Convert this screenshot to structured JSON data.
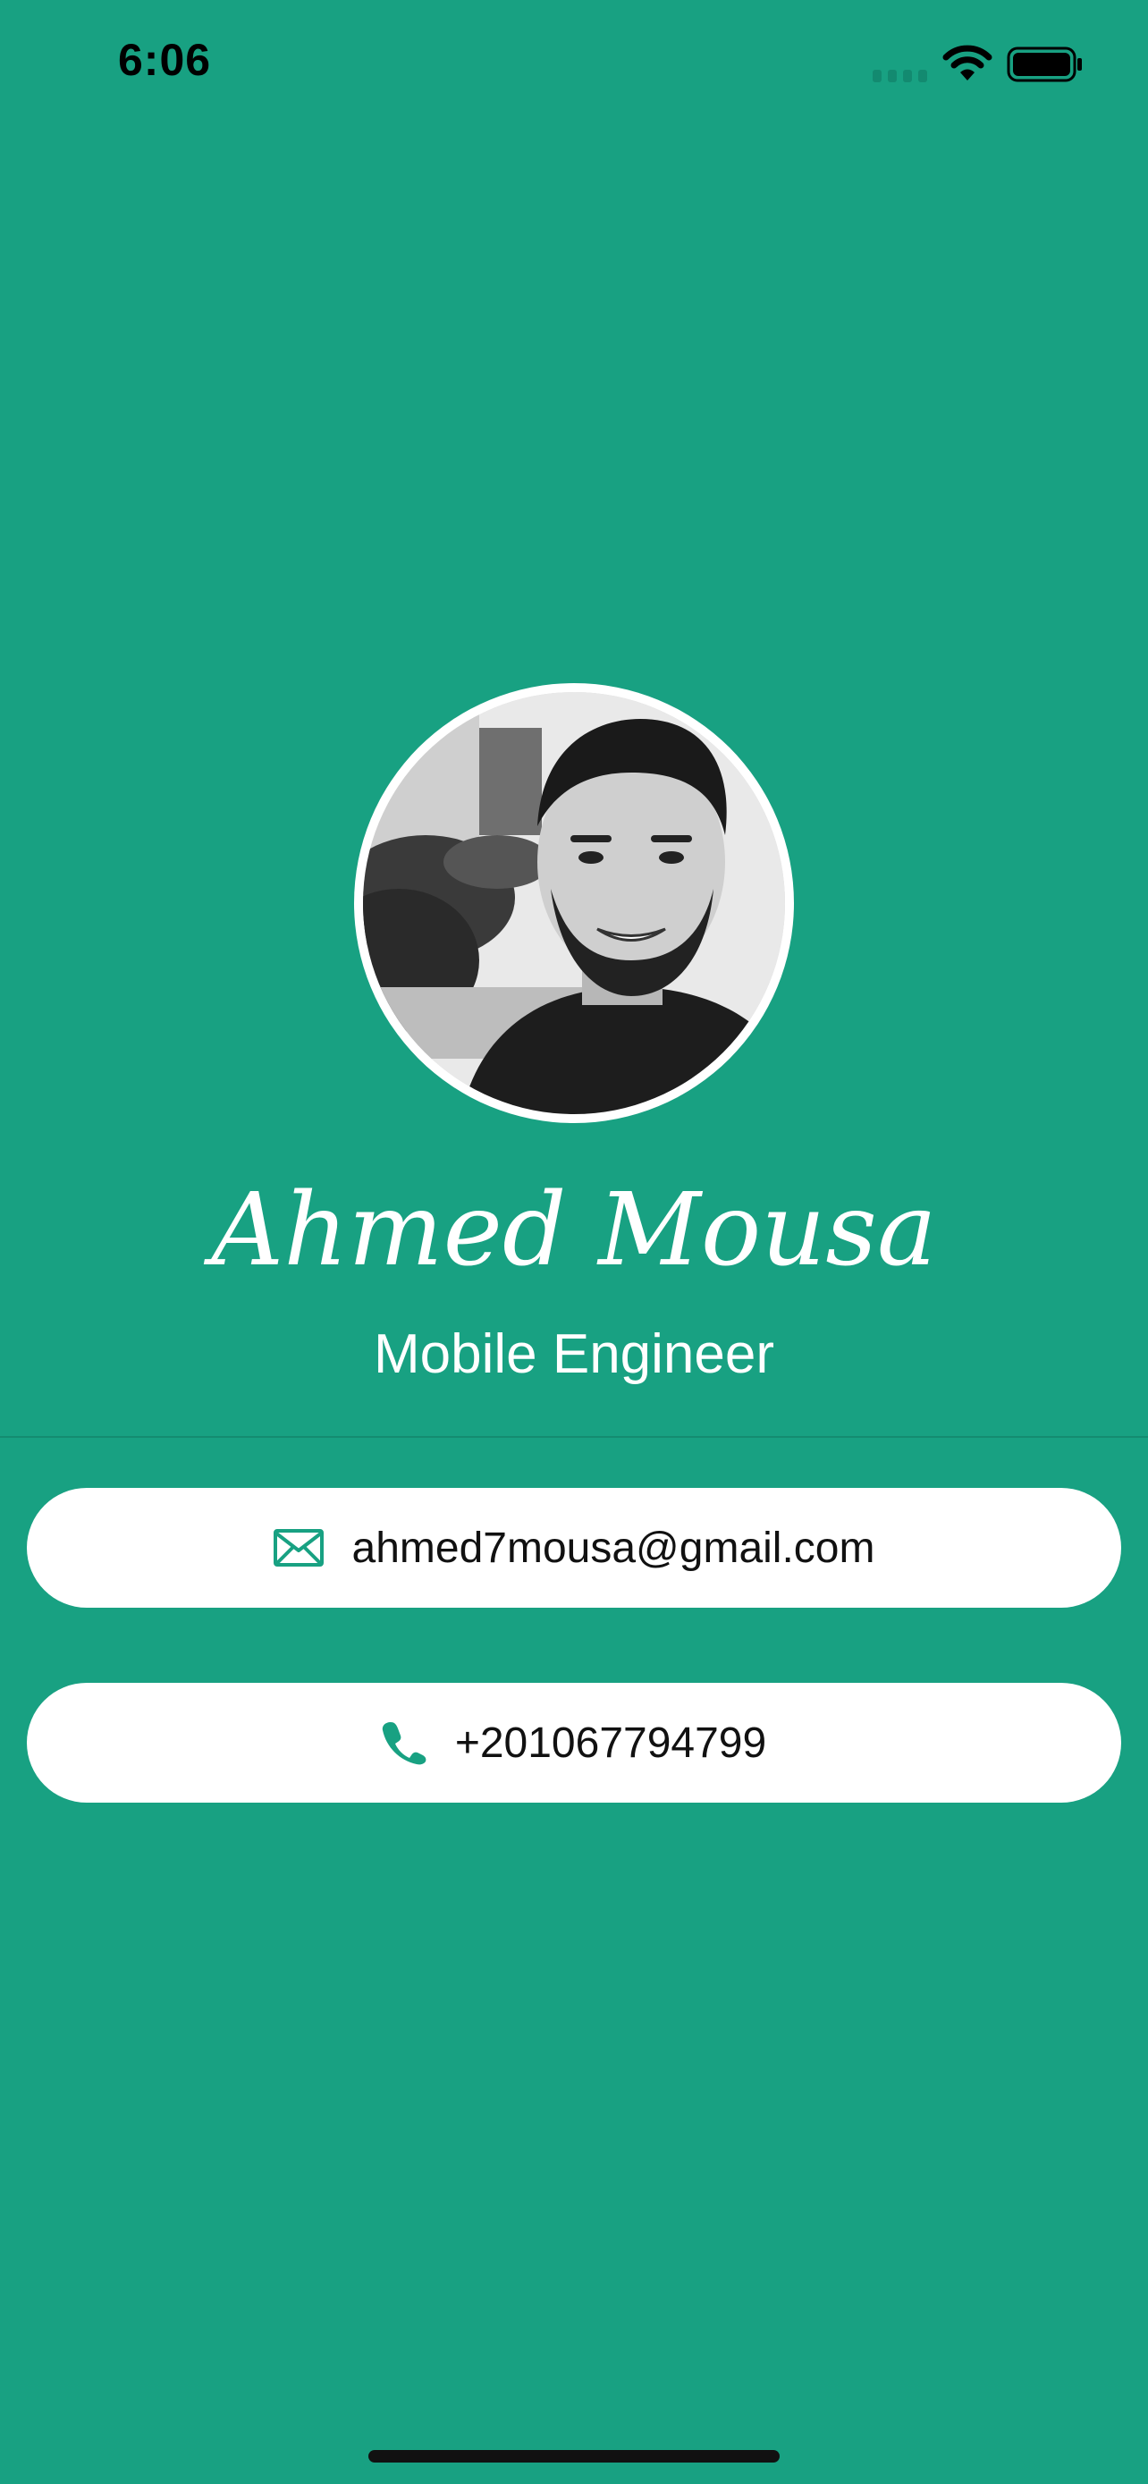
{
  "status_bar": {
    "time": "6:06"
  },
  "profile": {
    "name": "Ahmed Mousa",
    "role": "Mobile Engineer",
    "avatar_icon": "profile-photo"
  },
  "contacts": [
    {
      "icon": "envelope-icon",
      "value": "ahmed7mousa@gmail.com"
    },
    {
      "icon": "phone-icon",
      "value": "+201067794799"
    }
  ],
  "colors": {
    "background": "#18A182",
    "card": "#FFFFFF",
    "icon_accent": "#18A182",
    "text_dark": "#111111",
    "text_light": "#FFFFFF"
  }
}
